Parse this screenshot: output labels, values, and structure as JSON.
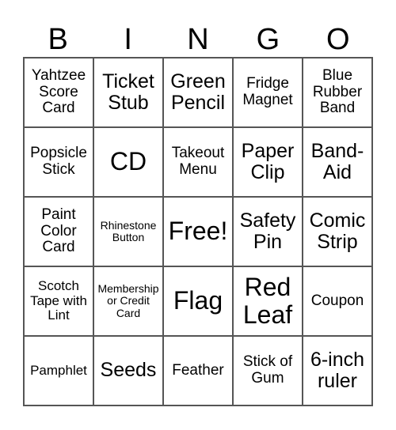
{
  "card": {
    "header": [
      "B",
      "I",
      "N",
      "G",
      "O"
    ],
    "cells": [
      {
        "text": "Yahtzee Score Card",
        "size": "s19"
      },
      {
        "text": "Ticket Stub",
        "size": "s25"
      },
      {
        "text": "Green Pencil",
        "size": "s25"
      },
      {
        "text": "Fridge Magnet",
        "size": "s19"
      },
      {
        "text": "Blue Rubber Band",
        "size": "s19"
      },
      {
        "text": "Popsicle Stick",
        "size": "s19"
      },
      {
        "text": "CD",
        "size": "s32"
      },
      {
        "text": "Takeout Menu",
        "size": "s19"
      },
      {
        "text": "Paper Clip",
        "size": "s25"
      },
      {
        "text": "Band-Aid",
        "size": "s25"
      },
      {
        "text": "Paint Color Card",
        "size": "s19"
      },
      {
        "text": "Rhinestone Button",
        "size": "s14"
      },
      {
        "text": "Free!",
        "size": "s32"
      },
      {
        "text": "Safety Pin",
        "size": "s25"
      },
      {
        "text": "Comic Strip",
        "size": "s25"
      },
      {
        "text": "Scotch Tape with Lint",
        "size": "s17"
      },
      {
        "text": "Membership or Credit Card",
        "size": "s14"
      },
      {
        "text": "Flag",
        "size": "s32"
      },
      {
        "text": "Red Leaf",
        "size": "s32"
      },
      {
        "text": "Coupon",
        "size": "s19"
      },
      {
        "text": "Pamphlet",
        "size": "s17"
      },
      {
        "text": "Seeds",
        "size": "s25"
      },
      {
        "text": "Feather",
        "size": "s19"
      },
      {
        "text": "Stick of Gum",
        "size": "s19"
      },
      {
        "text": "6-inch ruler",
        "size": "s25"
      }
    ]
  }
}
